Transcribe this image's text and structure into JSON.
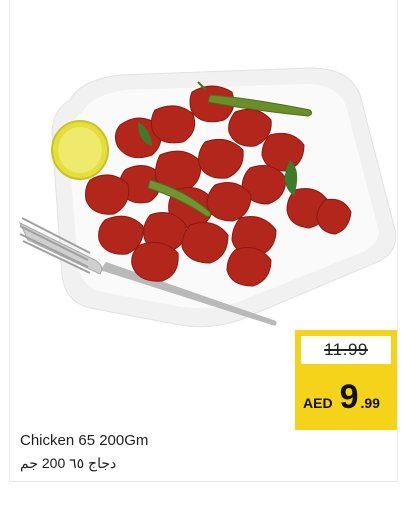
{
  "product": {
    "name_en": "Chicken 65 200Gm",
    "name_ar": "دجاج ٦٥ 200 جم",
    "image_alt": "chicken-65-plate"
  },
  "price": {
    "old": "11.99",
    "currency": "AED",
    "new_int": "9",
    "new_dec": ".99"
  },
  "colors": {
    "price_badge": "#f5d31a",
    "plate": "#f3f3f3",
    "chicken": "#b8281e",
    "lemon": "#e9e44a"
  }
}
